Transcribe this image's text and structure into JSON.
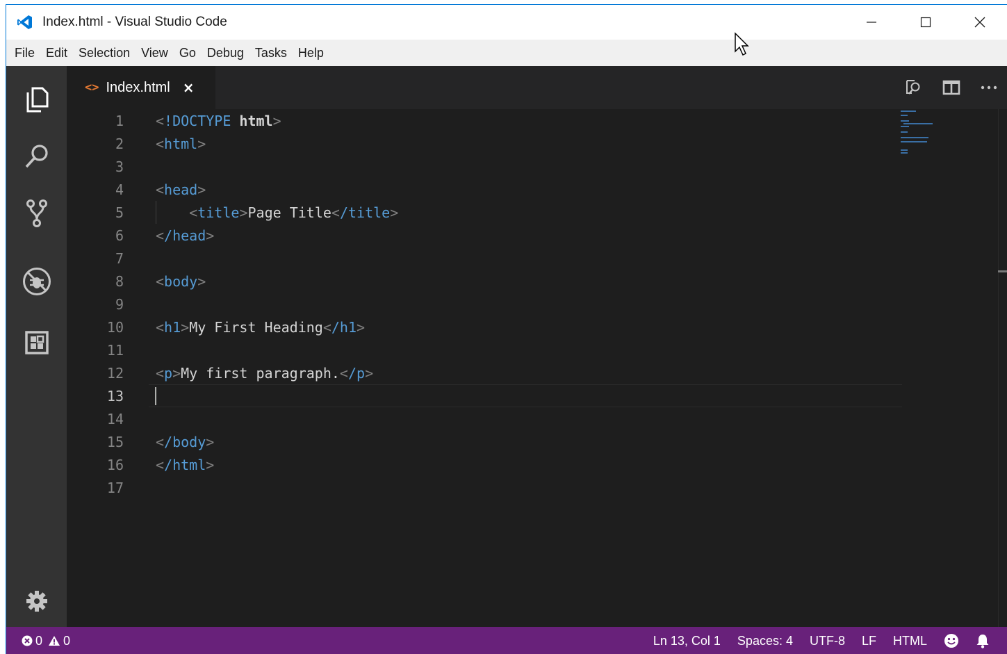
{
  "window": {
    "title": "Index.html - Visual Studio Code"
  },
  "menu": [
    "File",
    "Edit",
    "Selection",
    "View",
    "Go",
    "Debug",
    "Tasks",
    "Help"
  ],
  "tab": {
    "label": "Index.html",
    "close": "×",
    "icon": "<>"
  },
  "editor": {
    "active_line": 13,
    "lines": [
      {
        "n": "1"
      },
      {
        "n": "2"
      },
      {
        "n": "3"
      },
      {
        "n": "4"
      },
      {
        "n": "5"
      },
      {
        "n": "6"
      },
      {
        "n": "7"
      },
      {
        "n": "8"
      },
      {
        "n": "9"
      },
      {
        "n": "10"
      },
      {
        "n": "11"
      },
      {
        "n": "12"
      },
      {
        "n": "13"
      },
      {
        "n": "14"
      },
      {
        "n": "15"
      },
      {
        "n": "16"
      },
      {
        "n": "17"
      }
    ],
    "code": {
      "l1_doctype": "!DOCTYPE",
      "l1_html": "html",
      "l2_tag": "html",
      "l4_tag": "head",
      "l5_tag": "title",
      "l5_text": "Page Title",
      "l5_close": "/title",
      "l6_tag": "/head",
      "l8_tag": "body",
      "l10_tag": "h1",
      "l10_text": "My First Heading",
      "l10_close": "/h1",
      "l12_tag": "p",
      "l12_text": "My first paragraph.",
      "l12_close": "/p",
      "l15_tag": "/body",
      "l16_tag": "/html"
    }
  },
  "statusbar": {
    "errors": "0",
    "warnings": "0",
    "position": "Ln 13, Col 1",
    "spaces": "Spaces: 4",
    "encoding": "UTF-8",
    "eol": "LF",
    "language": "HTML"
  },
  "colors": {
    "statusbar": "#68217a",
    "activitybar": "#333333",
    "editor_bg": "#1e1e1e",
    "tag": "#569cd6",
    "tab_icon": "#e37933"
  }
}
